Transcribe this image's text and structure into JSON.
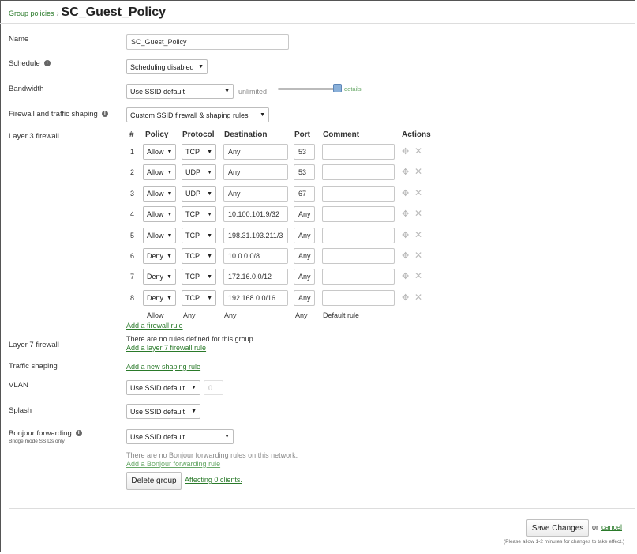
{
  "breadcrumb": {
    "parent_link": "Group policies",
    "separator": "›",
    "title": "SC_Guest_Policy"
  },
  "fields": {
    "name_label": "Name",
    "name_value": "SC_Guest_Policy",
    "schedule_label": "Schedule",
    "schedule_value": "Scheduling disabled",
    "bandwidth_label": "Bandwidth",
    "bandwidth_value": "Use SSID default",
    "bandwidth_limit_text": "unlimited",
    "bandwidth_details_link": "details",
    "bandwidth_slider_level": 1.0,
    "firewall_label": "Firewall and traffic shaping",
    "firewall_value": "Custom SSID firewall & shaping rules",
    "layer3_label": "Layer 3 firewall",
    "layer7_label": "Layer 7 firewall",
    "layer7_empty": "There are no rules defined for this group.",
    "layer7_add_link": "Add a layer 7 firewall rule",
    "traffic_shaping_label": "Traffic shaping",
    "traffic_shaping_link": "Add a new shaping rule",
    "vlan_label": "VLAN",
    "vlan_value": "Use SSID default",
    "vlan_number": "0",
    "splash_label": "Splash",
    "splash_value": "Use SSID default",
    "bonjour_label": "Bonjour forwarding",
    "bonjour_sublabel": "Bridge mode SSIDs only",
    "bonjour_value": "Use SSID default",
    "bonjour_empty": "There are no Bonjour forwarding rules on this network.",
    "bonjour_add_link": "Add a Bonjour forwarding rule"
  },
  "firewall_table": {
    "headers": {
      "num": "#",
      "policy": "Policy",
      "protocol": "Protocol",
      "destination": "Destination",
      "port": "Port",
      "comment": "Comment",
      "actions": "Actions"
    },
    "rows": [
      {
        "num": "1",
        "policy": "Allow",
        "protocol": "TCP",
        "destination": "Any",
        "port": "53",
        "comment": ""
      },
      {
        "num": "2",
        "policy": "Allow",
        "protocol": "UDP",
        "destination": "Any",
        "port": "53",
        "comment": ""
      },
      {
        "num": "3",
        "policy": "Allow",
        "protocol": "UDP",
        "destination": "Any",
        "port": "67",
        "comment": ""
      },
      {
        "num": "4",
        "policy": "Allow",
        "protocol": "TCP",
        "destination": "10.100.101.9/32",
        "port": "Any",
        "comment": ""
      },
      {
        "num": "5",
        "policy": "Allow",
        "protocol": "TCP",
        "destination": "198.31.193.211/3",
        "port": "Any",
        "comment": ""
      },
      {
        "num": "6",
        "policy": "Deny",
        "protocol": "TCP",
        "destination": "10.0.0.0/8",
        "port": "Any",
        "comment": ""
      },
      {
        "num": "7",
        "policy": "Deny",
        "protocol": "TCP",
        "destination": "172.16.0.0/12",
        "port": "Any",
        "comment": ""
      },
      {
        "num": "8",
        "policy": "Deny",
        "protocol": "TCP",
        "destination": "192.168.0.0/16",
        "port": "Any",
        "comment": ""
      }
    ],
    "default_row": {
      "policy": "Allow",
      "protocol": "Any",
      "destination": "Any",
      "port": "Any",
      "comment": "Default rule"
    },
    "add_rule_link": "Add a firewall rule"
  },
  "delete_group": {
    "button": "Delete group",
    "affecting_link": "Affecting 0 clients."
  },
  "footer": {
    "save_button": "Save Changes",
    "or_text": "or",
    "cancel_link": "cancel",
    "note": "(Please allow 1-2 minutes for changes to take effect.)"
  },
  "icons": {
    "info": "info-icon",
    "move": "move-icon",
    "delete": "close-icon",
    "dropdown": "chevron-down-icon"
  }
}
